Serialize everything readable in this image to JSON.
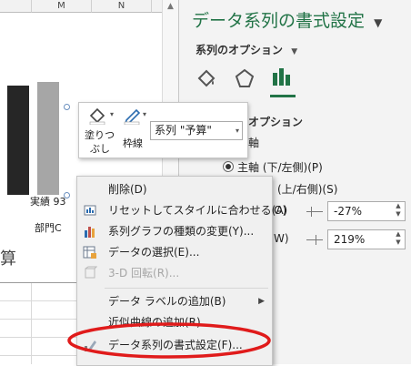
{
  "sheet": {
    "columns": [
      "M",
      "N"
    ],
    "chart": {
      "data_label": "実績 93",
      "category_label": "部門C",
      "partial_title": "算",
      "bar_colors": [
        "#262626",
        "#a6a6a6"
      ]
    }
  },
  "pane": {
    "title": "データ系列の書式設定",
    "subtitle": "系列のオプション",
    "section_header": "オプション",
    "axis_label": "軸",
    "radio_primary": "主軸 (下/左側)(P)",
    "radio_secondary": "(上/右側)(S)",
    "overlap_key": "O)",
    "overlap_value": "-27%",
    "gap_key": "W)",
    "gap_value": "219%"
  },
  "mini_toolbar": {
    "fill_label_line1": "塗りつ",
    "fill_label_line2": "ぶし",
    "outline_label": "枠線",
    "series_select_value": "系列 \"予算\""
  },
  "context_menu": {
    "items": [
      {
        "label": "削除(D)",
        "icon": "delete-icon",
        "enabled": true
      },
      {
        "label": "リセットしてスタイルに合わせる(A)",
        "icon": "reset-style-icon",
        "enabled": true
      },
      {
        "label": "系列グラフの種類の変更(Y)...",
        "icon": "chart-type-icon",
        "enabled": true
      },
      {
        "label": "データの選択(E)...",
        "icon": "select-data-icon",
        "enabled": true
      },
      {
        "label": "3-D 回転(R)...",
        "icon": "rotation-3d-icon",
        "enabled": false
      },
      {
        "label": "データ ラベルの追加(B)",
        "icon": "",
        "enabled": true,
        "submenu": true
      },
      {
        "label": "近似曲線の追加(R)...",
        "icon": "",
        "enabled": true
      },
      {
        "label": "データ系列の書式設定(F)...",
        "icon": "format-series-icon",
        "enabled": true,
        "highlighted": true
      }
    ]
  },
  "highlight_color": "#e01b1b",
  "accent_color": "#217346"
}
